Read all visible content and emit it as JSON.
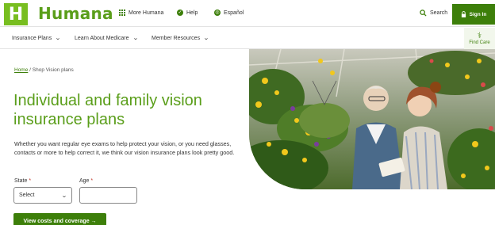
{
  "header": {
    "logo_mark": "H",
    "brand": "Humana",
    "more_label": "More Humana",
    "help_label": "Help",
    "language_label": "Español",
    "search_label": "Search",
    "signin_label": "Sign In"
  },
  "nav": {
    "items": [
      {
        "label": "Insurance Plans"
      },
      {
        "label": "Learn About Medicare"
      },
      {
        "label": "Member Resources"
      }
    ],
    "find_care_label": "Find Care"
  },
  "breadcrumb": {
    "home": "Home",
    "separator": "/",
    "current": "Shop Vision plans"
  },
  "main": {
    "title": "Individual and family vision insurance plans",
    "intro": "Whether you want regular eye exams to help protect your vision, or you need glasses, contacts or more to help correct it, we think our vision insurance plans look pretty good."
  },
  "form": {
    "state_label": "State",
    "age_label": "Age",
    "required_mark": "*",
    "state_value": "Select",
    "age_value": "",
    "cta_label": "View costs and coverage →"
  },
  "colors": {
    "brand_green": "#78be20",
    "dark_green": "#3d7f0a",
    "headline_green": "#5a9e1a"
  }
}
